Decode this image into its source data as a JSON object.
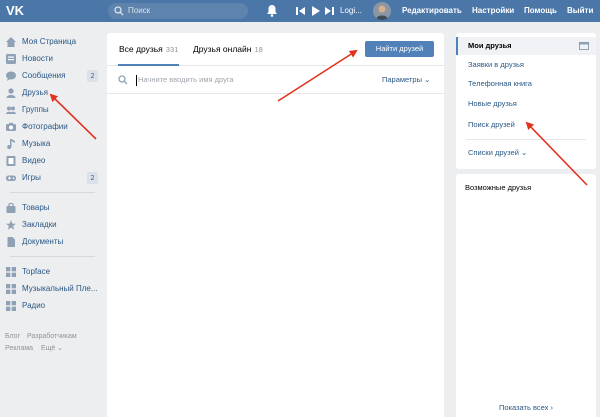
{
  "header": {
    "search_placeholder": "Поиск",
    "login_label": "Logi...",
    "links": [
      "Редактировать",
      "Настройки",
      "Помощь",
      "Выйти"
    ]
  },
  "sidebar": {
    "items": [
      {
        "label": "Моя Страница",
        "icon": "home-icon"
      },
      {
        "label": "Новости",
        "icon": "news-icon"
      },
      {
        "label": "Сообщения",
        "icon": "message-icon",
        "count": "2"
      },
      {
        "label": "Друзья",
        "icon": "user-icon"
      },
      {
        "label": "Группы",
        "icon": "group-icon"
      },
      {
        "label": "Фотографии",
        "icon": "camera-icon"
      },
      {
        "label": "Музыка",
        "icon": "music-icon"
      },
      {
        "label": "Видео",
        "icon": "video-icon"
      },
      {
        "label": "Игры",
        "icon": "gamepad-icon",
        "count": "2"
      },
      {
        "label": "Товары",
        "icon": "bag-icon"
      },
      {
        "label": "Закладки",
        "icon": "star-icon"
      },
      {
        "label": "Документы",
        "icon": "document-icon"
      },
      {
        "label": "Topface",
        "icon": "app-icon"
      },
      {
        "label": "Музыкальный Пле...",
        "icon": "app-icon"
      },
      {
        "label": "Радио",
        "icon": "app-icon"
      }
    ],
    "footer": [
      "Блог",
      "Разработчикам",
      "Реклама",
      "Ещё"
    ]
  },
  "main": {
    "tabs": [
      {
        "label": "Все друзья",
        "count": "331"
      },
      {
        "label": "Друзья онлайн",
        "count": "18"
      }
    ],
    "find_button": "Найти друзей",
    "search_placeholder": "Начните вводить имя друга",
    "params_label": "Параметры"
  },
  "right": {
    "items": [
      "Мои друзья",
      "Заявки в друзья",
      "Телефонная книга",
      "Новые друзья",
      "Поиск друзей"
    ],
    "lists_label": "Списки друзей",
    "possible_title": "Возможные друзья",
    "show_all": "Показать всех"
  },
  "colors": {
    "brand": "#4a76a8",
    "accent": "#5181b8",
    "link": "#2a5885",
    "annotation_arrow": "#e0331e"
  }
}
